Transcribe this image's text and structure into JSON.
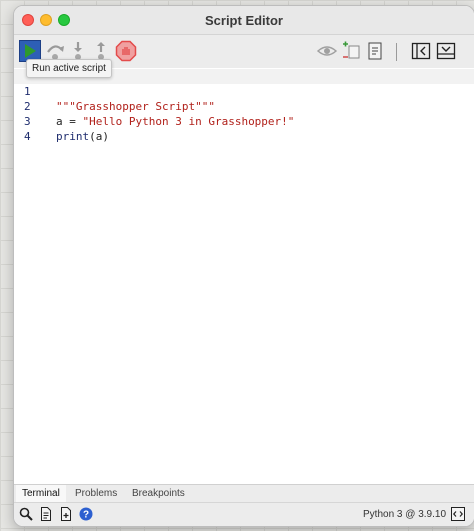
{
  "window": {
    "title": "Script Editor"
  },
  "toolbar": {
    "buttons": [
      {
        "icon": "play-icon",
        "color": "#2e9a2e"
      },
      {
        "icon": "step-over-icon"
      },
      {
        "icon": "step-into-icon"
      },
      {
        "icon": "step-out-icon"
      },
      {
        "icon": "stop-icon",
        "color": "#e34b4b"
      },
      {
        "icon": "eye-icon"
      },
      {
        "icon": "add-remove-icon"
      },
      {
        "icon": "document-icon"
      },
      {
        "icon": "collapse-panel-icon"
      },
      {
        "icon": "collapse-down-icon"
      }
    ],
    "tooltip": "Run active script"
  },
  "editor": {
    "lines": [
      {
        "number": "1",
        "text": "\"\"\"Grasshopper Script\"\"\""
      },
      {
        "number": "2",
        "text_pre": "a = ",
        "text_str": "\"Hello Python 3 in Grasshopper!\""
      },
      {
        "number": "3",
        "text_fn": "print",
        "text_rest": "(a)"
      },
      {
        "number": "4",
        "text": ""
      }
    ],
    "colors": {
      "string": "#b1211b",
      "keyword": "#1f2d6e"
    }
  },
  "tabs": [
    {
      "label": "Terminal",
      "active": true
    },
    {
      "label": "Problems",
      "active": false
    },
    {
      "label": "Breakpoints",
      "active": false
    }
  ],
  "status": {
    "icons": [
      "search-icon",
      "new-file-icon",
      "add-file-icon",
      "help-icon",
      "code-icon"
    ],
    "version": "Python 3 @ 3.9.10"
  }
}
